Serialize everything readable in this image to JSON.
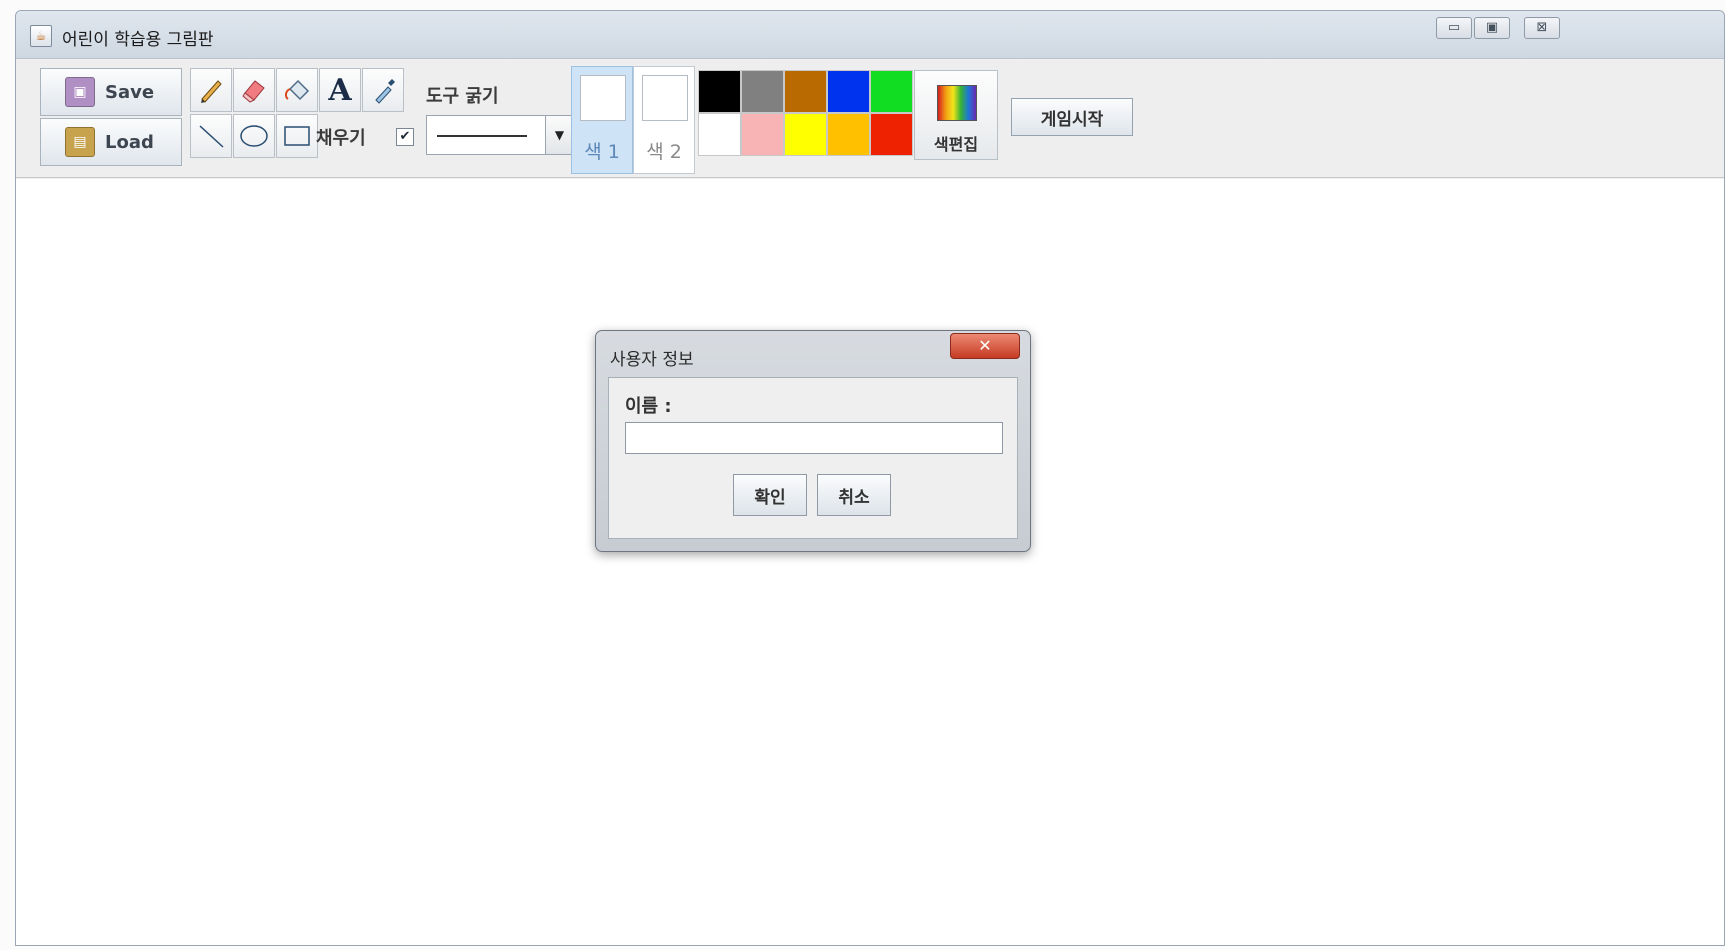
{
  "window": {
    "title": "어린이 학습용 그림판",
    "controls": {
      "minimize": "▭",
      "maximize": "▣",
      "close": "⊠"
    }
  },
  "toolbar": {
    "save_label": "Save",
    "load_label": "Load",
    "tools": [
      "pencil-icon",
      "eraser-icon",
      "fill-bucket-icon",
      "text-tool-icon",
      "eyedropper-icon",
      "line-tool-icon",
      "ellipse-tool-icon",
      "rectangle-tool-icon"
    ],
    "text_tool_glyph": "A",
    "fill_label": "채우기",
    "fill_checked": true,
    "fill_check_glyph": "✔",
    "thickness_label": "도구 굵기",
    "dropdown_arrow": "▼",
    "color1_label": "색 1",
    "color2_label": "색 2",
    "color1_value": "#ffffff",
    "color2_value": "#ffffff",
    "palette": [
      "#000000",
      "#808080",
      "#b96a00",
      "#0033ee",
      "#11dd22",
      "#ffffff",
      "#f8b4b4",
      "#ffff00",
      "#ffc000",
      "#ee2200"
    ],
    "color_edit_label": "색편집",
    "game_start_label": "게임시작"
  },
  "dialog": {
    "title": "사용자 정보",
    "close_glyph": "✕",
    "name_label": "이름 :",
    "name_value": "",
    "ok_label": "확인",
    "cancel_label": "취소"
  }
}
